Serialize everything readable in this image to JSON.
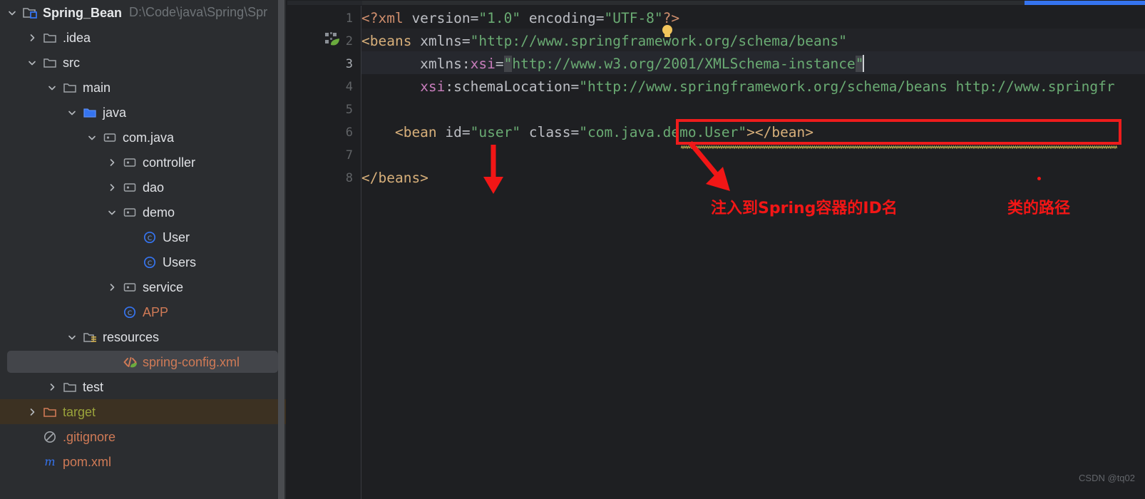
{
  "project": {
    "name": "Spring_Bean",
    "path": "D:\\Code\\java\\Spring\\Spr",
    "icon": "project-module-icon"
  },
  "sidebar": {
    "items": [
      {
        "label": ".idea",
        "indent": 1,
        "arrow": "right",
        "icon": "folder-icon",
        "color": "white",
        "selected": false
      },
      {
        "label": "src",
        "indent": 1,
        "arrow": "down",
        "icon": "folder-icon",
        "color": "white",
        "selected": false
      },
      {
        "label": "main",
        "indent": 2,
        "arrow": "down",
        "icon": "folder-icon",
        "color": "white",
        "selected": false
      },
      {
        "label": "java",
        "indent": 3,
        "arrow": "down",
        "icon": "source-folder-icon",
        "color": "white",
        "selected": false
      },
      {
        "label": "com.java",
        "indent": 4,
        "arrow": "down",
        "icon": "package-icon",
        "color": "white",
        "selected": false
      },
      {
        "label": "controller",
        "indent": 5,
        "arrow": "right",
        "icon": "package-icon",
        "color": "white",
        "selected": false
      },
      {
        "label": "dao",
        "indent": 5,
        "arrow": "right",
        "icon": "package-icon",
        "color": "white",
        "selected": false
      },
      {
        "label": "demo",
        "indent": 5,
        "arrow": "down",
        "icon": "package-icon",
        "color": "white",
        "selected": false
      },
      {
        "label": "User",
        "indent": 6,
        "arrow": "none",
        "icon": "java-class-icon",
        "color": "white",
        "selected": false
      },
      {
        "label": "Users",
        "indent": 6,
        "arrow": "none",
        "icon": "java-class-icon",
        "color": "white",
        "selected": false
      },
      {
        "label": "service",
        "indent": 5,
        "arrow": "right",
        "icon": "package-icon",
        "color": "white",
        "selected": false
      },
      {
        "label": "APP",
        "indent": 5,
        "arrow": "none",
        "icon": "java-class-icon",
        "color": "orange",
        "selected": false
      },
      {
        "label": "resources",
        "indent": 3,
        "arrow": "down",
        "icon": "resources-folder-icon",
        "color": "white",
        "selected": false
      },
      {
        "label": "spring-config.xml",
        "indent": 5,
        "arrow": "none",
        "icon": "spring-xml-icon",
        "color": "orange",
        "selected": true
      },
      {
        "label": "test",
        "indent": 2,
        "arrow": "right",
        "icon": "folder-icon",
        "color": "white",
        "selected": false
      },
      {
        "label": "target",
        "indent": 1,
        "arrow": "right",
        "icon": "excluded-folder-icon",
        "color": "olive",
        "selected": false,
        "row_highlight": true
      },
      {
        "label": ".gitignore",
        "indent": 1,
        "arrow": "none",
        "icon": "gitignore-icon",
        "color": "orange",
        "selected": false
      },
      {
        "label": "pom.xml",
        "indent": 1,
        "arrow": "none",
        "icon": "maven-icon",
        "color": "orange",
        "selected": false
      }
    ]
  },
  "editor": {
    "gutter_lines": [
      "1",
      "2",
      "3",
      "4",
      "5",
      "6",
      "7",
      "8"
    ],
    "current_line": 3,
    "spring_bean_gutter_icon": "spring-bean-icon",
    "intention_bulb_icon": "intention-bulb-icon",
    "lines": [
      {
        "num": 1,
        "text": "<?xml version=\"1.0\" encoding=\"UTF-8\"?>"
      },
      {
        "num": 2,
        "text": "<beans xmlns=\"http://www.springframework.org/schema/beans\""
      },
      {
        "num": 3,
        "text": "       xmlns:xsi=\"http://www.w3.org/2001/XMLSchema-instance\""
      },
      {
        "num": 4,
        "text": "       xsi:schemaLocation=\"http://www.springframework.org/schema/beans http://www.springfr"
      },
      {
        "num": 5,
        "text": ""
      },
      {
        "num": 6,
        "text": "    <bean id=\"user\" class=\"com.java.demo.User\"></bean>"
      },
      {
        "num": 7,
        "text": ""
      },
      {
        "num": 8,
        "text": "</beans>"
      }
    ],
    "tokens": {
      "l1": [
        {
          "t": "<?xml",
          "c": "proc"
        },
        {
          "t": " version=",
          "c": "attr"
        },
        {
          "t": "\"1.0\"",
          "c": "val"
        },
        {
          "t": " encoding=",
          "c": "attr"
        },
        {
          "t": "\"UTF-8\"",
          "c": "val"
        },
        {
          "t": "?>",
          "c": "proc"
        }
      ],
      "l2": [
        {
          "t": "<beans",
          "c": "tag"
        },
        {
          "t": " xmlns=",
          "c": "attr"
        },
        {
          "t": "\"http://www.springframework.org/schema/beans\"",
          "c": "val"
        }
      ],
      "l3": [
        {
          "t": "       xmlns:",
          "c": "attr"
        },
        {
          "t": "xsi",
          "c": "ns"
        },
        {
          "t": "=",
          "c": "attr"
        },
        {
          "t": "\"",
          "c": "val-sel"
        },
        {
          "t": "http://www.w3.org/2001/XMLSchema-instance",
          "c": "val"
        },
        {
          "t": "\"",
          "c": "val-sel"
        }
      ],
      "l4": [
        {
          "t": "       ",
          "c": "attr"
        },
        {
          "t": "xsi",
          "c": "ns"
        },
        {
          "t": ":schemaLocation=",
          "c": "attr"
        },
        {
          "t": "\"http://www.springframework.org/schema/beans http://www.springfr",
          "c": "val"
        }
      ],
      "l6": [
        {
          "t": "    <bean",
          "c": "tag"
        },
        {
          "t": " id=",
          "c": "attr"
        },
        {
          "t": "\"user\"",
          "c": "val"
        },
        {
          "t": " class=",
          "c": "attr"
        },
        {
          "t": "\"com.java.demo.User\"",
          "c": "val"
        },
        {
          "t": ">",
          "c": "tag"
        },
        {
          "t": "</bean>",
          "c": "tag"
        }
      ],
      "l8": [
        {
          "t": "</beans>",
          "c": "tag"
        }
      ]
    }
  },
  "annotations": {
    "box_label": "bean-declaration-highlight-box",
    "note_id": "注入到Spring容器的ID名",
    "note_class": "类的路径",
    "accent_color": "#f21616"
  },
  "watermark": {
    "text": "CSDN @tq02"
  },
  "colors": {
    "sidebar_bg": "#2b2d30",
    "editor_bg": "#1e1f22",
    "selection_bg": "#43454a",
    "target_row_bg": "#3c3122",
    "scrollbar_blue": "#3574f0",
    "string_green": "#6aab73",
    "tag_orange": "#d7af7a",
    "ns_pink": "#c77dbb"
  }
}
